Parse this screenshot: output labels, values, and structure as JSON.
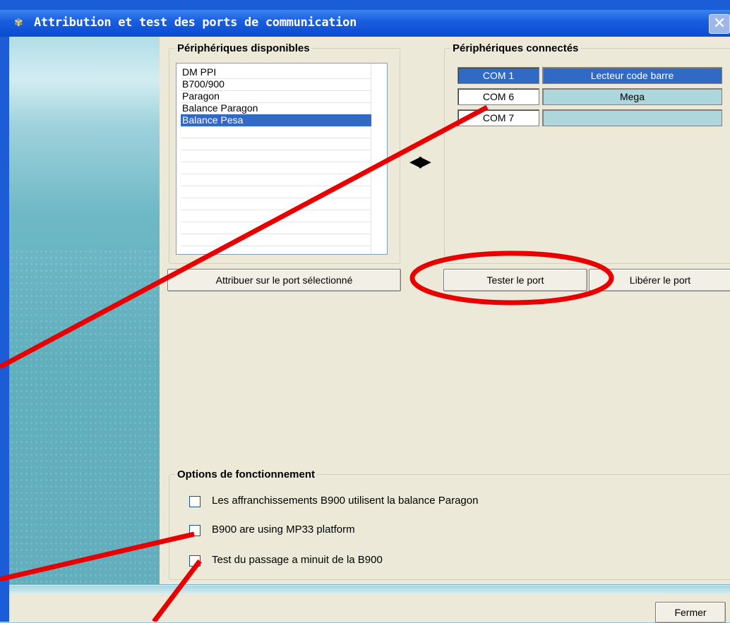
{
  "window": {
    "title": "Attribution et test des ports de communication",
    "title_icon": "app-gear-icon",
    "close_glyph": "✕"
  },
  "available": {
    "legend": "Périphériques disponibles",
    "items": [
      "DM PPI",
      "B700/900",
      "Paragon",
      "Balance Paragon",
      "Balance Pesa"
    ],
    "selected_index": 4
  },
  "transfer_arrows": "◀▶",
  "connected": {
    "legend": "Périphériques connectés",
    "rows": [
      {
        "port": "COM 1",
        "device": "Lecteur code barre",
        "selected": true
      },
      {
        "port": "COM 6",
        "device": "Mega",
        "selected": false
      },
      {
        "port": "COM 7",
        "device": "",
        "selected": false
      }
    ]
  },
  "buttons": {
    "assign": "Attribuer sur le port sélectionné",
    "test": "Tester le port",
    "release": "Libérer le port",
    "close": "Fermer"
  },
  "options": {
    "legend": "Options de fonctionnement",
    "checks": [
      {
        "label": "Les affranchissements B900 utilisent la balance Paragon",
        "checked": false
      },
      {
        "label": "B900 are using MP33 platform",
        "checked": false
      },
      {
        "label": "Test du passage a minuit de la B900",
        "checked": false
      }
    ]
  },
  "annotation_color": "#e80000"
}
